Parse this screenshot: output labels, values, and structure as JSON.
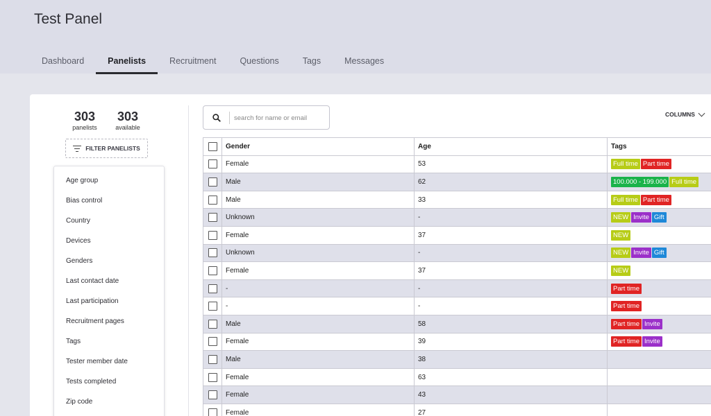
{
  "app": {
    "title": "Test Panel"
  },
  "tabs": [
    {
      "label": "Dashboard",
      "active": false
    },
    {
      "label": "Panelists",
      "active": true
    },
    {
      "label": "Recruitment",
      "active": false
    },
    {
      "label": "Questions",
      "active": false
    },
    {
      "label": "Tags",
      "active": false
    },
    {
      "label": "Messages",
      "active": false
    }
  ],
  "stats": {
    "panelists": {
      "value": "303",
      "label": "panelists"
    },
    "available": {
      "value": "303",
      "label": "available"
    }
  },
  "filter": {
    "button_label": "FILTER PANELISTS",
    "items": [
      "Age group",
      "Bias control",
      "Country",
      "Devices",
      "Genders",
      "Last contact date",
      "Last participation",
      "Recruitment pages",
      "Tags",
      "Tester member date",
      "Tests completed",
      "Zip code"
    ]
  },
  "search": {
    "placeholder": "search for name or email",
    "value": ""
  },
  "columns_button": {
    "label": "COLUMNS"
  },
  "table": {
    "headers": [
      "Gender",
      "Age",
      "Tags"
    ],
    "rows": [
      {
        "gender": "Female",
        "age": "53",
        "tags": [
          {
            "label": "Full time",
            "color": "#b7cc17"
          },
          {
            "label": "Part time",
            "color": "#e02424"
          }
        ]
      },
      {
        "gender": "Male",
        "age": "62",
        "tags": [
          {
            "label": "100.000 - 199.000",
            "color": "#1ab34a"
          },
          {
            "label": "Full time",
            "color": "#b7cc17"
          }
        ]
      },
      {
        "gender": "Male",
        "age": "33",
        "tags": [
          {
            "label": "Full time",
            "color": "#b7cc17"
          },
          {
            "label": "Part time",
            "color": "#e02424"
          }
        ]
      },
      {
        "gender": "Unknown",
        "age": "-",
        "tags": [
          {
            "label": "NEW",
            "color": "#b7cc17"
          },
          {
            "label": "Invite",
            "color": "#9b30c9"
          },
          {
            "label": "Gift",
            "color": "#1e88d8"
          }
        ]
      },
      {
        "gender": "Female",
        "age": "37",
        "tags": [
          {
            "label": "NEW",
            "color": "#b7cc17"
          }
        ]
      },
      {
        "gender": "Unknown",
        "age": "-",
        "tags": [
          {
            "label": "NEW",
            "color": "#b7cc17"
          },
          {
            "label": "Invite",
            "color": "#9b30c9"
          },
          {
            "label": "Gift",
            "color": "#1e88d8"
          }
        ]
      },
      {
        "gender": "Female",
        "age": "37",
        "tags": [
          {
            "label": "NEW",
            "color": "#b7cc17"
          }
        ]
      },
      {
        "gender": "-",
        "age": "-",
        "tags": [
          {
            "label": "Part time",
            "color": "#e02424"
          }
        ]
      },
      {
        "gender": "-",
        "age": "-",
        "tags": [
          {
            "label": "Part time",
            "color": "#e02424"
          }
        ]
      },
      {
        "gender": "Male",
        "age": "58",
        "tags": [
          {
            "label": "Part time",
            "color": "#e02424"
          },
          {
            "label": "Invite",
            "color": "#9b30c9"
          }
        ]
      },
      {
        "gender": "Female",
        "age": "39",
        "tags": [
          {
            "label": "Part time",
            "color": "#e02424"
          },
          {
            "label": "Invite",
            "color": "#9b30c9"
          }
        ]
      },
      {
        "gender": "Male",
        "age": "38",
        "tags": []
      },
      {
        "gender": "Female",
        "age": "63",
        "tags": []
      },
      {
        "gender": "Female",
        "age": "43",
        "tags": []
      },
      {
        "gender": "Female",
        "age": "27",
        "tags": []
      }
    ]
  }
}
